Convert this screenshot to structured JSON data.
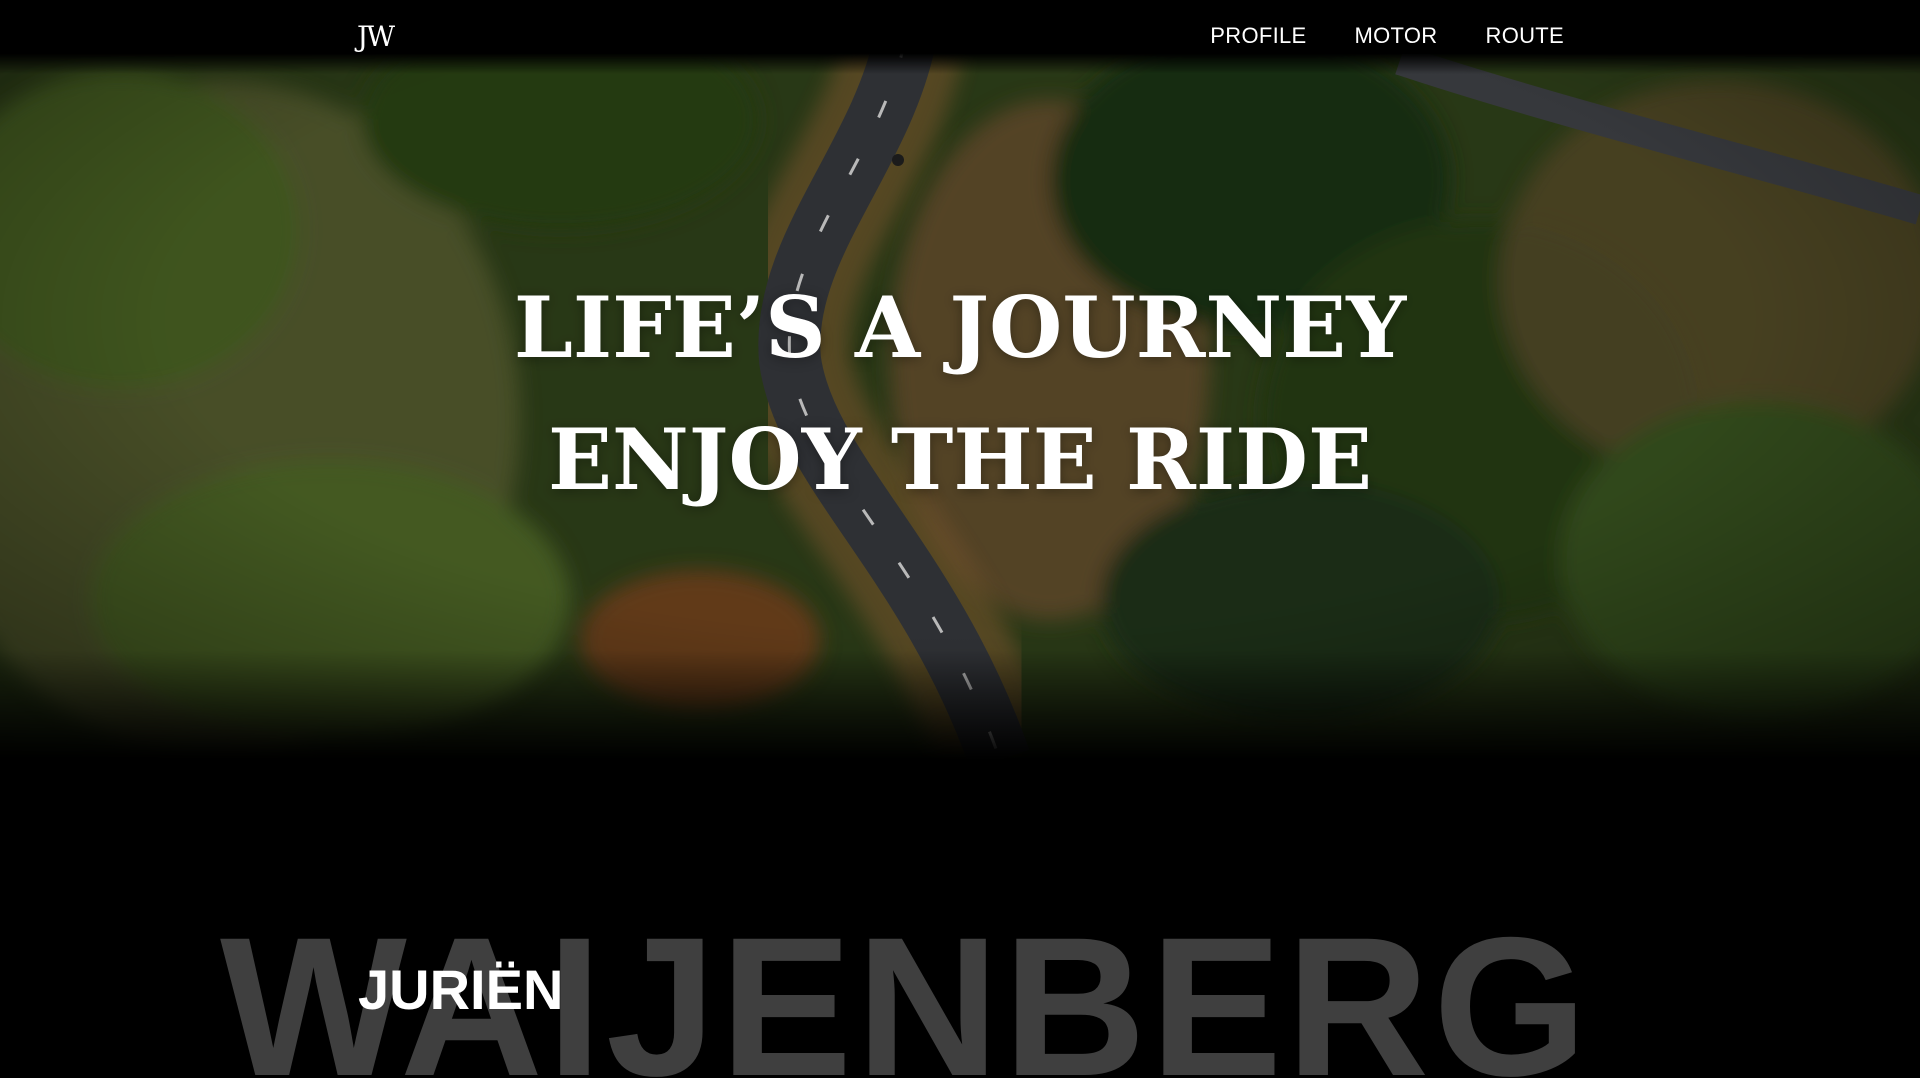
{
  "nav": {
    "logo": "JW",
    "links": [
      "PROFILE",
      "MOTOR",
      "ROUTE"
    ]
  },
  "hero": {
    "headline_line1": "LIFE’S A JOURNEY",
    "headline_line2": "ENJOY THE RIDE"
  },
  "name": {
    "first": "JURIËN",
    "last": "WAIJENBERG"
  },
  "colors": {
    "background": "#000000",
    "text": "#ffffff",
    "surname": "#3f3f3f",
    "forest": "#3e5322",
    "road": "#3a3d42",
    "dirt": "#8a5a2c"
  }
}
